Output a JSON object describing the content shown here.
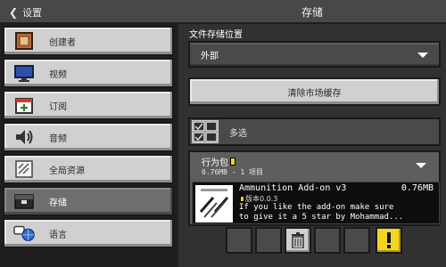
{
  "header": {
    "back_label": "设置",
    "title": "存储"
  },
  "sidebar": {
    "items": [
      {
        "label": "创建者",
        "icon": "creator-icon",
        "active": false
      },
      {
        "label": "视频",
        "icon": "monitor-icon",
        "active": false
      },
      {
        "label": "订阅",
        "icon": "calendar-plus-icon",
        "active": false
      },
      {
        "label": "音频",
        "icon": "speaker-icon",
        "active": false
      },
      {
        "label": "全局资源",
        "icon": "global-resources-icon",
        "active": false
      },
      {
        "label": "存储",
        "icon": "storage-chest-icon",
        "active": true
      },
      {
        "label": "语言",
        "icon": "language-globe-icon",
        "active": false
      }
    ]
  },
  "main": {
    "storage_location_label": "文件存储位置",
    "storage_location_value": "外部",
    "clear_cache_label": "清除市场缓存",
    "multiselect_label": "多选",
    "pack": {
      "title": "行为包",
      "meta": "0.76MB - 1 项目"
    },
    "addon": {
      "name": "Ammunition Add-on v3",
      "size": "0.76MB",
      "version": "版本0.0.3",
      "description_line1": "If you like the add-on make sure",
      "description_line2": "to give it a 5 star by Mohammad..."
    }
  },
  "colors": {
    "accent_warning": "#f2d422",
    "button_light": "#d0d0d0",
    "panel_dark": "#4a4a4a"
  }
}
